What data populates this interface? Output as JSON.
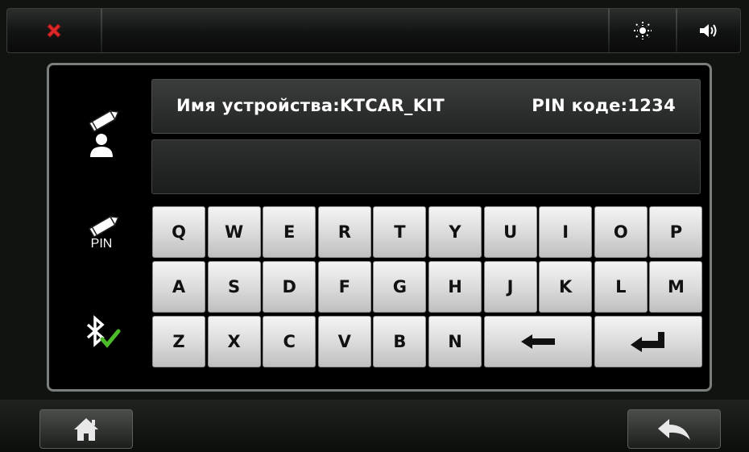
{
  "topbar": {
    "close_icon": "close-icon",
    "brightness_icon": "brightness-icon",
    "volume_icon": "volume-icon"
  },
  "sidebar": {
    "items": [
      {
        "name": "edit-device-name",
        "icon": "edit-user-icon"
      },
      {
        "name": "edit-pin",
        "icon": "edit-pin-icon",
        "label": "PIN"
      },
      {
        "name": "bluetooth-confirm",
        "icon": "bluetooth-check-icon"
      }
    ]
  },
  "info": {
    "device_name_text": "Имя устройства:KTCAR_KIT",
    "pin_text": "PIN коде:1234"
  },
  "input": {
    "value": ""
  },
  "keyboard": {
    "row1": [
      "Q",
      "W",
      "E",
      "R",
      "T",
      "Y",
      "U",
      "I",
      "O",
      "P"
    ],
    "row2": [
      "A",
      "S",
      "D",
      "F",
      "G",
      "H",
      "J",
      "K",
      "L",
      "M"
    ],
    "row3": [
      "Z",
      "X",
      "C",
      "V",
      "B",
      "N"
    ],
    "backspace_icon": "backspace-arrow-icon",
    "enter_icon": "enter-arrow-icon"
  },
  "bottombar": {
    "home_icon": "home-icon",
    "back_icon": "back-arrow-icon"
  }
}
